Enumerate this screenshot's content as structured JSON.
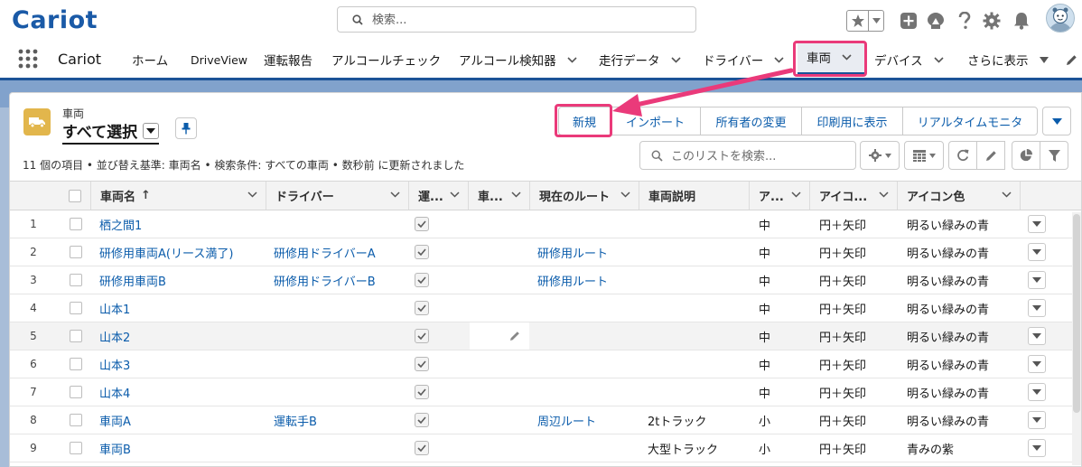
{
  "header": {
    "logo": "Cariot",
    "search_placeholder": "検索..."
  },
  "nav": {
    "app_name": "Cariot",
    "items": [
      {
        "label": "ホーム",
        "chevron": false
      },
      {
        "label": "DriveView",
        "chevron": false
      },
      {
        "label": "運転報告",
        "chevron": false
      },
      {
        "label": "アルコールチェック",
        "chevron": false
      },
      {
        "label": "アルコール検知器",
        "chevron": true
      },
      {
        "label": "走行データ",
        "chevron": true
      },
      {
        "label": "ドライバー",
        "chevron": true
      },
      {
        "label": "車両",
        "chevron": true,
        "active": true
      },
      {
        "label": "デバイス",
        "chevron": true
      },
      {
        "label": "さらに表示",
        "chevron": true
      }
    ]
  },
  "list_view": {
    "object_label": "車両",
    "view_name": "すべて選択",
    "summary": "11 個の項目 • 並び替え基準: 車両名 • 検索条件: すべての車両 • 数秒前 に更新されました",
    "search_placeholder": "このリストを検索...",
    "buttons": {
      "new": "新規",
      "import": "インポート",
      "change_owner": "所有者の変更",
      "print": "印刷用に表示",
      "realtime": "リアルタイムモニタ"
    },
    "columns": [
      "車両名",
      "ドライバー",
      "運...",
      "車...",
      "現在のルート",
      "車両説明",
      "ア...",
      "アイコ...",
      "アイコン色"
    ],
    "sort_indicator": "↑",
    "rows": [
      {
        "num": "1",
        "name": "栖之間1",
        "driver": "",
        "route": "",
        "desc": "",
        "size": "中",
        "icon": "円＋矢印",
        "color": "明るい緑みの青"
      },
      {
        "num": "2",
        "name": "研修用車両A(リース満了)",
        "driver": "研修用ドライバーA",
        "route": "研修用ルート",
        "desc": "",
        "size": "中",
        "icon": "円＋矢印",
        "color": "明るい緑みの青"
      },
      {
        "num": "3",
        "name": "研修用車両B",
        "driver": "研修用ドライバーB",
        "route": "研修用ルート",
        "desc": "",
        "size": "中",
        "icon": "円＋矢印",
        "color": "明るい緑みの青"
      },
      {
        "num": "4",
        "name": "山本1",
        "driver": "",
        "route": "",
        "desc": "",
        "size": "中",
        "icon": "円＋矢印",
        "color": "明るい緑みの青"
      },
      {
        "num": "5",
        "name": "山本2",
        "driver": "",
        "route": "",
        "desc": "",
        "size": "中",
        "icon": "円＋矢印",
        "color": "明るい緑みの青"
      },
      {
        "num": "6",
        "name": "山本3",
        "driver": "",
        "route": "",
        "desc": "",
        "size": "中",
        "icon": "円＋矢印",
        "color": "明るい緑みの青"
      },
      {
        "num": "7",
        "name": "山本4",
        "driver": "",
        "route": "",
        "desc": "",
        "size": "中",
        "icon": "円＋矢印",
        "color": "明るい緑みの青"
      },
      {
        "num": "8",
        "name": "車両A",
        "driver": "運転手B",
        "route": "周辺ルート",
        "desc": "2tトラック",
        "size": "小",
        "icon": "円＋矢印",
        "color": "明るい緑みの青"
      },
      {
        "num": "9",
        "name": "車両B",
        "driver": "",
        "route": "",
        "desc": "大型トラック",
        "size": "小",
        "icon": "円＋矢印",
        "color": "青みの紫"
      }
    ]
  },
  "colors": {
    "brand": "#1a5aa7",
    "link": "#0b5cab",
    "highlight": "#ea3a7a",
    "object_icon": "#e2b64c"
  }
}
